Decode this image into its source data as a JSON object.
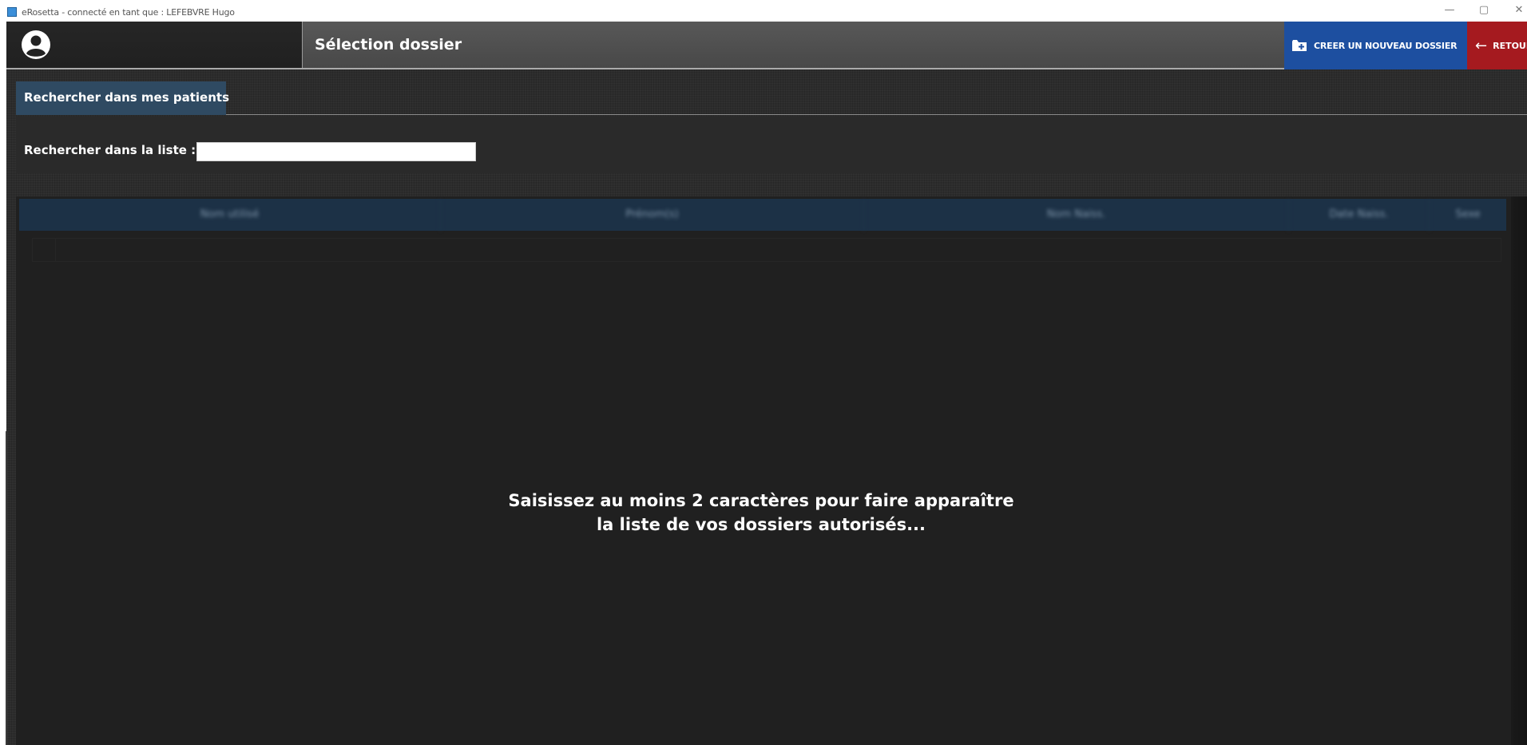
{
  "window": {
    "title": "eRosetta - connecté en tant que : LEFEBVRE Hugo",
    "controls": {
      "minimize": "—",
      "maximize": "▢",
      "close": "✕"
    }
  },
  "header": {
    "page_title": "Sélection dossier",
    "new_folder_label": "CREER UN NOUVEAU DOSSIER",
    "back_label": "RETOUR",
    "back_arrow": "←"
  },
  "tabs": [
    {
      "label": "Rechercher dans mes patients",
      "active": true
    }
  ],
  "search": {
    "label": "Rechercher dans la liste :",
    "value": ""
  },
  "table": {
    "columns": [
      "Nom utilisé",
      "Prénom(s)",
      "Nom Naiss.",
      "Date Naiss.",
      "Sexe"
    ],
    "empty_message_line1": "Saisissez au moins 2 caractères pour faire apparaître",
    "empty_message_line2": "la liste de vos dossiers autorisés..."
  },
  "colors": {
    "new_button": "#1d4fa0",
    "back_button": "#a51a1f",
    "tab_active": "#2f4a62",
    "table_header": "#1c3146"
  }
}
